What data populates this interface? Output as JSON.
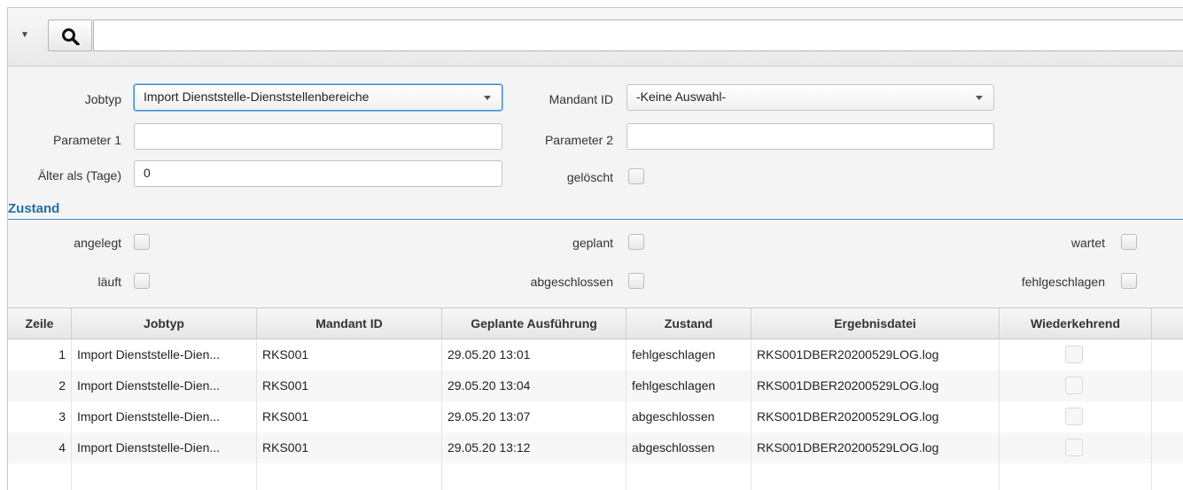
{
  "search": {
    "placeholder": "",
    "value": ""
  },
  "form": {
    "jobtyp_label": "Jobtyp",
    "jobtyp_value": "Import Dienststelle-Dienststellenbereiche",
    "mandant_label": "Mandant ID",
    "mandant_value": "-Keine Auswahl-",
    "param1_label": "Parameter 1",
    "param1_value": "",
    "param2_label": "Parameter 2",
    "param2_value": "",
    "aelter_label": "Älter als (Tage)",
    "aelter_value": "0",
    "geloescht_label": "gelöscht"
  },
  "zustand": {
    "title": "Zustand",
    "angelegt": "angelegt",
    "geplant": "geplant",
    "wartet": "wartet",
    "laeuft": "läuft",
    "abgeschlossen": "abgeschlossen",
    "fehlgeschlagen": "fehlgeschlagen"
  },
  "table": {
    "headers": [
      "Zeile",
      "Jobtyp",
      "Mandant ID",
      "Geplante Ausführung",
      "Zustand",
      "Ergebnisdatei",
      "Wiederkehrend"
    ],
    "rows": [
      {
        "zeile": "1",
        "jobtyp": "Import Dienststelle-Dien...",
        "mandant": "RKS001",
        "geplant": "29.05.20 13:01",
        "zustand": "fehlgeschlagen",
        "datei": "RKS001DBER20200529LOG.log"
      },
      {
        "zeile": "2",
        "jobtyp": "Import Dienststelle-Dien...",
        "mandant": "RKS001",
        "geplant": "29.05.20 13:04",
        "zustand": "fehlgeschlagen",
        "datei": "RKS001DBER20200529LOG.log"
      },
      {
        "zeile": "3",
        "jobtyp": "Import Dienststelle-Dien...",
        "mandant": "RKS001",
        "geplant": "29.05.20 13:07",
        "zustand": "abgeschlossen",
        "datei": "RKS001DBER20200529LOG.log"
      },
      {
        "zeile": "4",
        "jobtyp": "Import Dienststelle-Dien...",
        "mandant": "RKS001",
        "geplant": "29.05.20 13:12",
        "zustand": "abgeschlossen",
        "datei": "RKS001DBER20200529LOG.log"
      }
    ]
  },
  "colors": {
    "accent": "#1f6fad",
    "focus": "#3b8cd8"
  }
}
